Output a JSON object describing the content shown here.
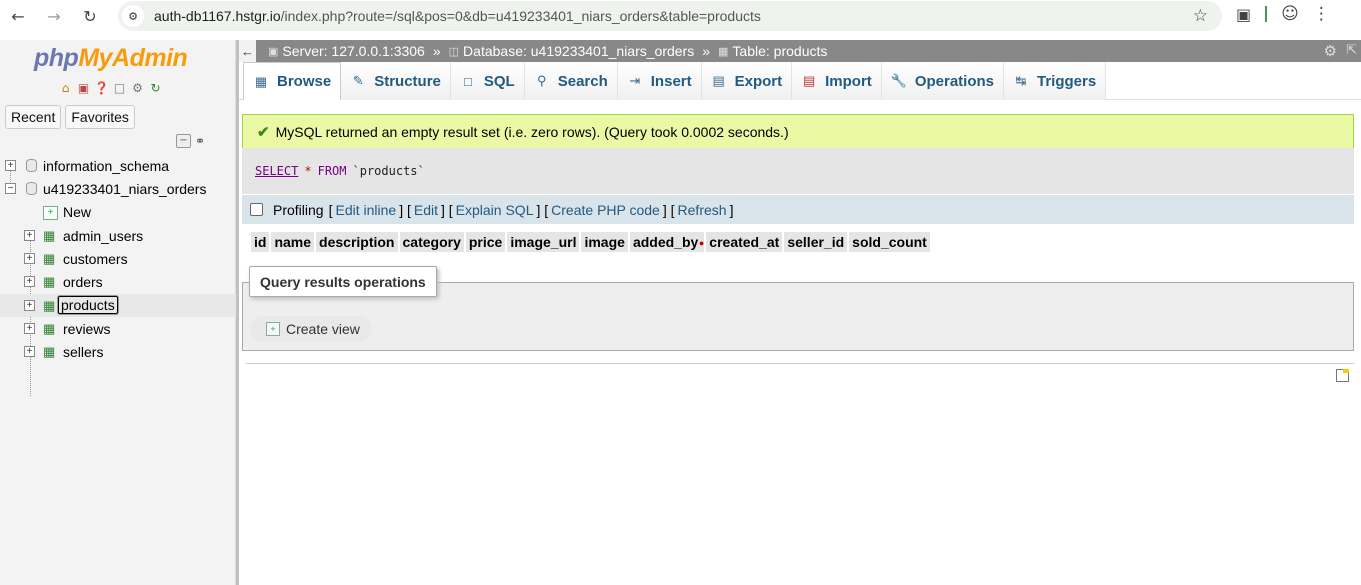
{
  "browser": {
    "url_host": "auth-db1167.hstgr.io",
    "url_path": "/index.php?route=/sql&pos=0&db=u419233401_niars_orders&table=products"
  },
  "nav": {
    "logo_php": "php",
    "logo_myadmin": "MyAdmin",
    "recent_label": "Recent",
    "favorites_label": "Favorites",
    "tree": [
      {
        "label": "information_schema"
      },
      {
        "label": "u419233401_niars_orders"
      },
      {
        "label": "New"
      },
      {
        "label": "admin_users"
      },
      {
        "label": "customers"
      },
      {
        "label": "orders"
      },
      {
        "label": "products"
      },
      {
        "label": "reviews"
      },
      {
        "label": "sellers"
      }
    ]
  },
  "breadcrumb": {
    "server": "Server: 127.0.0.1:3306",
    "database": "Database: u419233401_niars_orders",
    "table": "Table: products"
  },
  "tabs": [
    {
      "label": "Browse"
    },
    {
      "label": "Structure"
    },
    {
      "label": "SQL"
    },
    {
      "label": "Search"
    },
    {
      "label": "Insert"
    },
    {
      "label": "Export"
    },
    {
      "label": "Import"
    },
    {
      "label": "Operations"
    },
    {
      "label": "Triggers"
    }
  ],
  "message": {
    "text": "MySQL returned an empty result set (i.e. zero rows). (Query took 0.0002 seconds.)"
  },
  "sql": {
    "keyword": "SELECT",
    "star": "*",
    "from": "FROM",
    "table": "`products`"
  },
  "profiling": {
    "label": "Profiling",
    "links": [
      "Edit inline",
      "Edit",
      "Explain SQL",
      "Create PHP code",
      "Refresh"
    ]
  },
  "columns": [
    "id",
    "name",
    "description",
    "category",
    "price",
    "image_url",
    "image",
    "added_by",
    "created_at",
    "seller_id",
    "sold_count"
  ],
  "query_ops": {
    "legend": "Query results operations",
    "create_view": "Create view"
  }
}
